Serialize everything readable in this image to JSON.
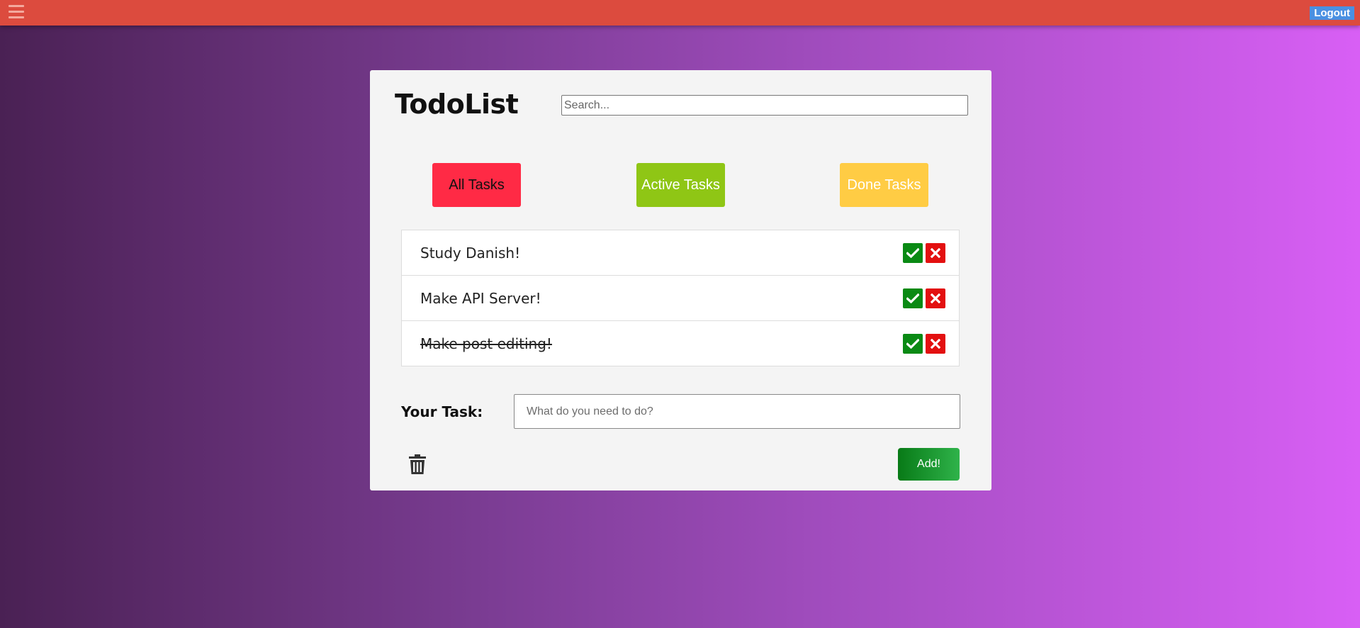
{
  "topbar": {
    "logout_label": "Logout",
    "menu_icon": "hamburger-menu-icon",
    "color": "#dc4b3e"
  },
  "app": {
    "title": "TodoList"
  },
  "search": {
    "placeholder": "Search..."
  },
  "filters": [
    {
      "label": "All Tasks",
      "color": "#ff2a45"
    },
    {
      "label": "Active Tasks",
      "color": "#8fc615"
    },
    {
      "label": "Done Tasks",
      "color": "#ffcc44"
    }
  ],
  "tasks": [
    {
      "text": "Study Danish!",
      "done": false
    },
    {
      "text": "Make API Server!",
      "done": false
    },
    {
      "text": "Make post editing!",
      "done": true
    }
  ],
  "task_actions": {
    "complete_icon": "check-icon",
    "delete_icon": "x-icon"
  },
  "new_task": {
    "label": "Your Task:",
    "placeholder": "What do you need to do?",
    "clear_icon": "trash-icon",
    "add_label": "Add!"
  }
}
